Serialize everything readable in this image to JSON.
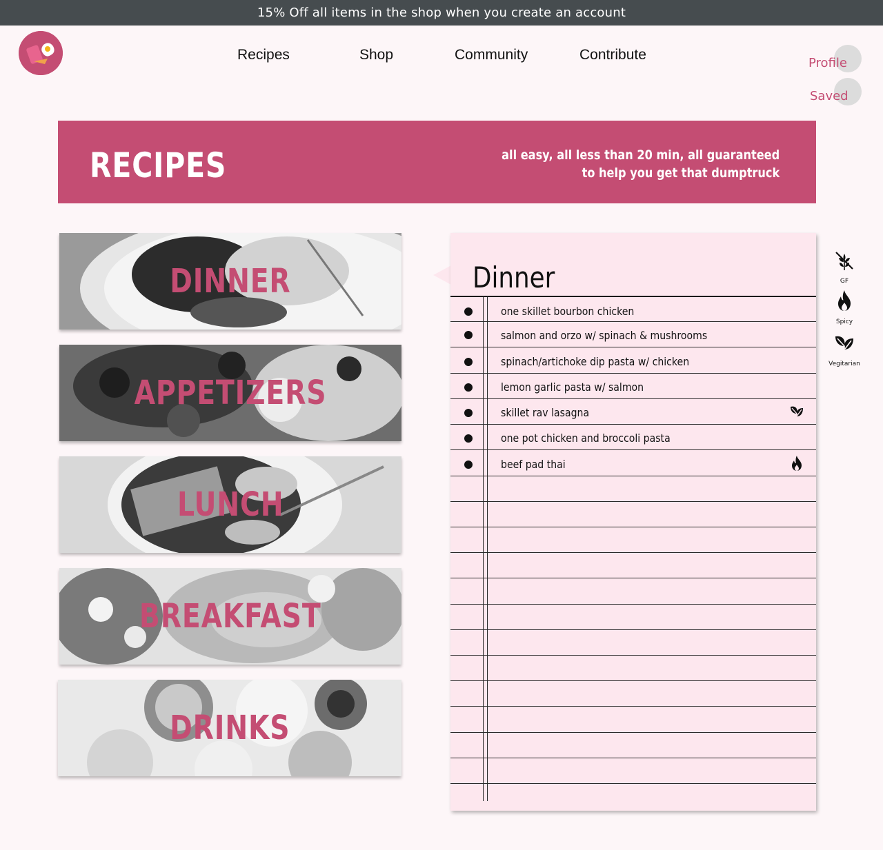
{
  "promo": {
    "text": "15% Off all items in the shop when you create an account"
  },
  "nav": {
    "items": [
      "Recipes",
      "Shop",
      "Community",
      "Contribute"
    ]
  },
  "account": {
    "profile": "Profile",
    "saved": "Saved"
  },
  "hero": {
    "title": "RECIPES",
    "tagline_line1": "all easy, all less than 20 min, all guaranteed",
    "tagline_line2": "to help you get that dumptruck"
  },
  "categories": [
    "DINNER",
    "APPETIZERS",
    "LUNCH",
    "BREAKFAST",
    "DRINKS"
  ],
  "notebook": {
    "title": "Dinner",
    "recipes": [
      {
        "name": "one skillet bourbon chicken",
        "icon": ""
      },
      {
        "name": "salmon and orzo w/ spinach & mushrooms",
        "icon": ""
      },
      {
        "name": "spinach/artichoke dip pasta w/ chicken",
        "icon": ""
      },
      {
        "name": "lemon garlic pasta w/ salmon",
        "icon": ""
      },
      {
        "name": "skillet rav lasagna",
        "icon": "vegetarian-icon"
      },
      {
        "name": "one pot chicken and broccoli pasta",
        "icon": ""
      },
      {
        "name": "beef pad thai",
        "icon": "spicy-icon"
      }
    ]
  },
  "legend": {
    "gf": "GF",
    "spicy": "Spicy",
    "vegetarian": "Vegitarian"
  },
  "colors": {
    "accent": "#c44d73",
    "promo_bg": "#464c4f",
    "page_bg": "#fdf6f8",
    "notebook_bg": "#fde7ee"
  }
}
